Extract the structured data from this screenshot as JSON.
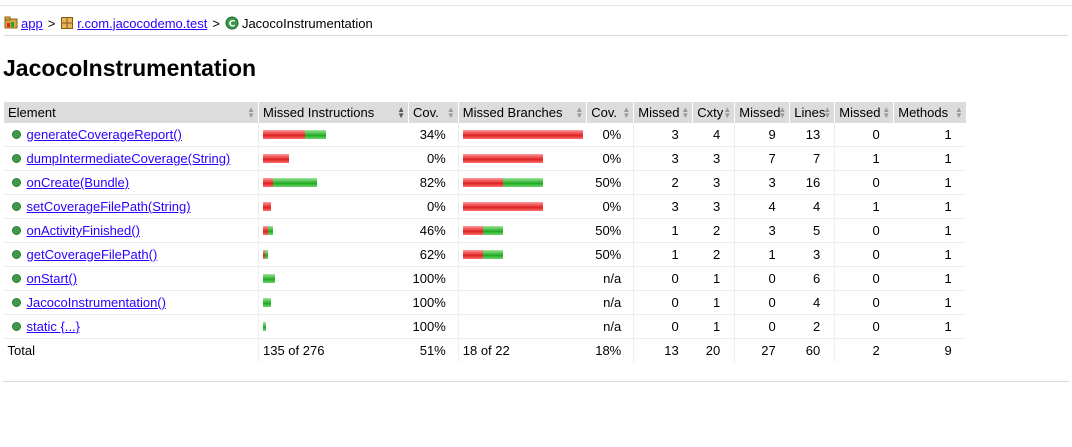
{
  "breadcrumb": {
    "app": "app",
    "package": "r.com.jacocodemo.test",
    "class": "JacocoInstrumentation",
    "separator": ">"
  },
  "page_title": "JacocoInstrumentation",
  "headers": {
    "element": "Element",
    "missed_instructions": "Missed Instructions",
    "cov1": "Cov.",
    "missed_branches": "Missed Branches",
    "cov2": "Cov.",
    "missed1": "Missed",
    "cxty": "Cxty",
    "missed2": "Missed",
    "lines": "Lines",
    "missed3": "Missed",
    "methods": "Methods"
  },
  "rows": [
    {
      "name": "generateCoverageReport()",
      "instr_red": 0.28,
      "instr_green": 0.14,
      "instr_cov": "34%",
      "br_red": 1.0,
      "br_green": 0.0,
      "br_cov": "0%",
      "missed_cxty": "3",
      "cxty": "4",
      "missed_lines": "9",
      "lines": "13",
      "missed_methods": "0",
      "methods": "1"
    },
    {
      "name": "dumpIntermediateCoverage(String)",
      "instr_red": 0.17,
      "instr_green": 0.0,
      "instr_cov": "0%",
      "br_red": 0.67,
      "br_green": 0.0,
      "br_cov": "0%",
      "missed_cxty": "3",
      "cxty": "3",
      "missed_lines": "7",
      "lines": "7",
      "missed_methods": "1",
      "methods": "1"
    },
    {
      "name": "onCreate(Bundle)",
      "instr_red": 0.065,
      "instr_green": 0.29,
      "instr_cov": "82%",
      "br_red": 0.33,
      "br_green": 0.33,
      "br_cov": "50%",
      "missed_cxty": "2",
      "cxty": "3",
      "missed_lines": "3",
      "lines": "16",
      "missed_methods": "0",
      "methods": "1"
    },
    {
      "name": "setCoverageFilePath(String)",
      "instr_red": 0.055,
      "instr_green": 0.0,
      "instr_cov": "0%",
      "br_red": 0.67,
      "br_green": 0.0,
      "br_cov": "0%",
      "missed_cxty": "3",
      "cxty": "3",
      "missed_lines": "4",
      "lines": "4",
      "missed_methods": "1",
      "methods": "1"
    },
    {
      "name": "onActivityFinished()",
      "instr_red": 0.035,
      "instr_green": 0.035,
      "instr_cov": "46%",
      "br_red": 0.17,
      "br_green": 0.17,
      "br_cov": "50%",
      "missed_cxty": "1",
      "cxty": "2",
      "missed_lines": "3",
      "lines": "5",
      "missed_methods": "0",
      "methods": "1"
    },
    {
      "name": "getCoverageFilePath()",
      "instr_red": 0.013,
      "instr_green": 0.022,
      "instr_cov": "62%",
      "br_red": 0.17,
      "br_green": 0.17,
      "br_cov": "50%",
      "missed_cxty": "1",
      "cxty": "2",
      "missed_lines": "1",
      "lines": "3",
      "missed_methods": "0",
      "methods": "1"
    },
    {
      "name": "onStart()",
      "instr_red": 0.0,
      "instr_green": 0.078,
      "instr_cov": "100%",
      "br_red": 0.0,
      "br_green": 0.0,
      "br_cov": "n/a",
      "missed_cxty": "0",
      "cxty": "1",
      "missed_lines": "0",
      "lines": "6",
      "missed_methods": "0",
      "methods": "1"
    },
    {
      "name": "JacocoInstrumentation()",
      "instr_red": 0.0,
      "instr_green": 0.052,
      "instr_cov": "100%",
      "br_red": 0.0,
      "br_green": 0.0,
      "br_cov": "n/a",
      "missed_cxty": "0",
      "cxty": "1",
      "missed_lines": "0",
      "lines": "4",
      "missed_methods": "0",
      "methods": "1"
    },
    {
      "name": "static {...}",
      "instr_red": 0.0,
      "instr_green": 0.022,
      "instr_cov": "100%",
      "br_red": 0.0,
      "br_green": 0.0,
      "br_cov": "n/a",
      "missed_cxty": "0",
      "cxty": "1",
      "missed_lines": "0",
      "lines": "2",
      "missed_methods": "0",
      "methods": "1"
    }
  ],
  "total": {
    "label": "Total",
    "instr": "135 of 276",
    "instr_cov": "51%",
    "br": "18 of 22",
    "br_cov": "18%",
    "missed_cxty": "13",
    "cxty": "20",
    "missed_lines": "27",
    "lines": "60",
    "missed_methods": "2",
    "methods": "9"
  },
  "colors": {
    "link": "#2a00ff",
    "missed_bar": "#e02020",
    "covered_bar": "#1fa81f",
    "header_bg": "#dcdcdc",
    "method_dot": "#3f9a46"
  },
  "icons": {
    "app": "report-folder-icon",
    "package": "package-icon",
    "class": "class-c-icon",
    "method": "public-method-dot-icon",
    "sort": "sort-arrows-icon"
  }
}
